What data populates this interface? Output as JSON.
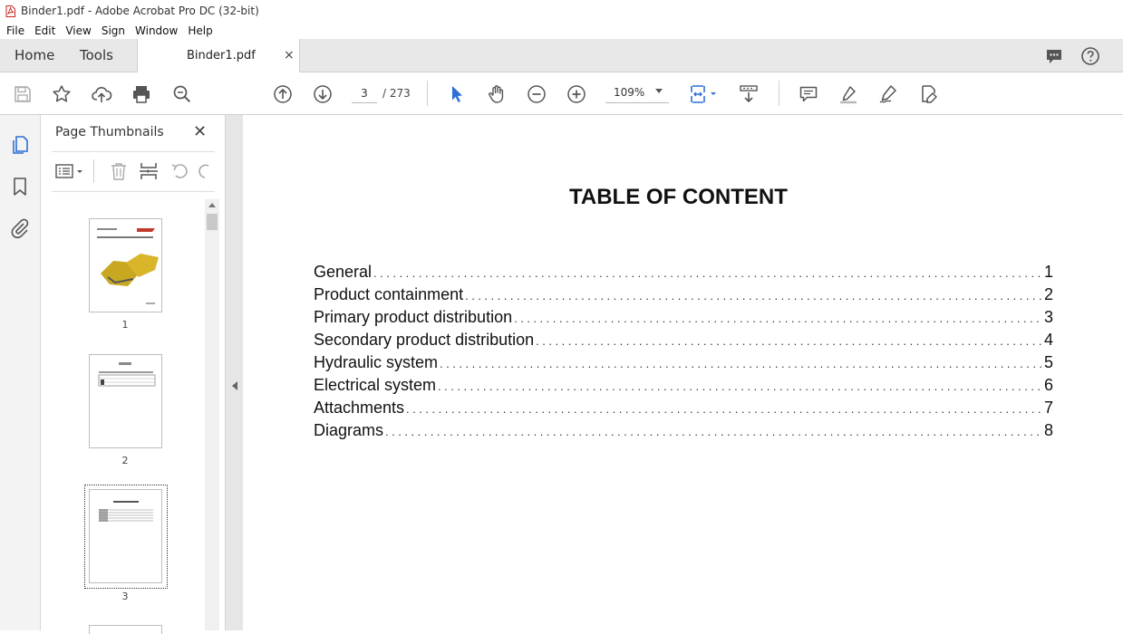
{
  "window": {
    "title": "Binder1.pdf - Adobe Acrobat Pro DC (32-bit)"
  },
  "menu": [
    "File",
    "Edit",
    "View",
    "Sign",
    "Window",
    "Help"
  ],
  "tabs": {
    "home": "Home",
    "tools": "Tools",
    "document": "Binder1.pdf",
    "close_glyph": "×"
  },
  "toolbar": {
    "current_page": "3",
    "page_of": "/  273",
    "zoom": "109%"
  },
  "thumbnails": {
    "title": "Page Thumbnails",
    "close_glyph": "✕",
    "pages": [
      "1",
      "2",
      "3"
    ],
    "selected_page": 3
  },
  "document": {
    "heading": "TABLE OF CONTENT",
    "entries": [
      {
        "name": "General",
        "page": "1"
      },
      {
        "name": "Product containment",
        "page": "2"
      },
      {
        "name": "Primary product distribution",
        "page": "3"
      },
      {
        "name": "Secondary product distribution",
        "page": "4"
      },
      {
        "name": "Hydraulic system",
        "page": "5"
      },
      {
        "name": "Electrical system",
        "page": "6"
      },
      {
        "name": "Attachments",
        "page": "7"
      },
      {
        "name": "Diagrams",
        "page": "8"
      }
    ]
  },
  "colors": {
    "accent": "#2d6fd6",
    "tab_bg": "#e8e8e8",
    "icon": "#555555"
  }
}
